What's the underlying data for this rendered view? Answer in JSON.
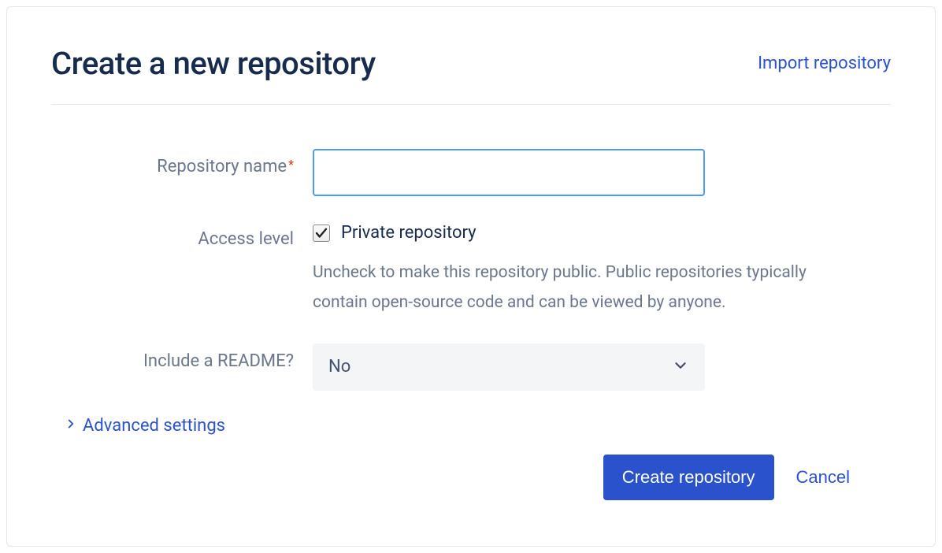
{
  "header": {
    "title": "Create a new repository",
    "import_link": "Import repository"
  },
  "form": {
    "repo_name": {
      "label": "Repository name",
      "value": ""
    },
    "access_level": {
      "label": "Access level",
      "checkbox_label": "Private repository",
      "checked": true,
      "help": "Uncheck to make this repository public. Public repositories typically contain open-source code and can be viewed by anyone."
    },
    "readme": {
      "label": "Include a README?",
      "value": "No"
    },
    "advanced": {
      "label": "Advanced settings"
    }
  },
  "actions": {
    "submit": "Create repository",
    "cancel": "Cancel"
  }
}
